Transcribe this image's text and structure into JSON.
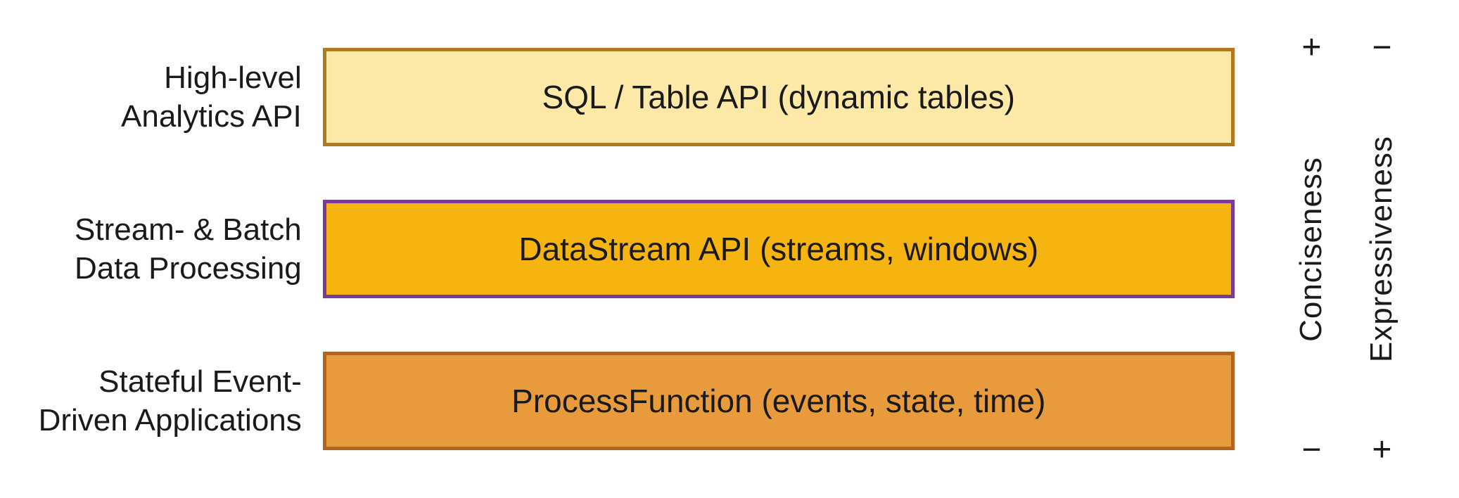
{
  "labels": [
    {
      "line1": "High-level",
      "line2": "Analytics API"
    },
    {
      "line1": "Stream- & Batch",
      "line2": "Data Processing"
    },
    {
      "line1": "Stateful Event-",
      "line2": "Driven Applications"
    }
  ],
  "layers": [
    {
      "text": "SQL / Table API (dynamic tables)"
    },
    {
      "text": "DataStream API (streams, windows)"
    },
    {
      "text": "ProcessFunction (events, state, time)"
    }
  ],
  "axes": [
    {
      "top_sign": "+",
      "label": "Conciseness",
      "bottom_sign": "−"
    },
    {
      "top_sign": "−",
      "label": "Expressiveness",
      "bottom_sign": "+"
    }
  ]
}
